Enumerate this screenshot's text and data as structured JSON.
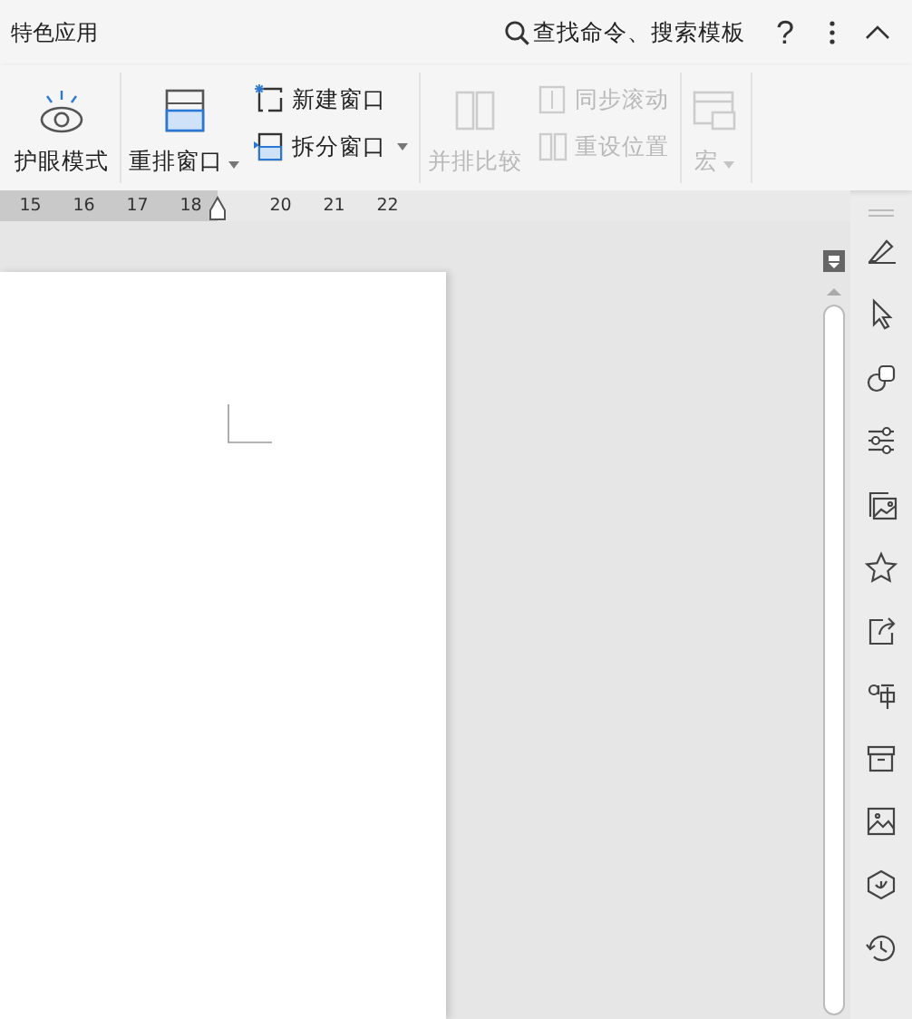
{
  "header": {
    "title": "特色应用",
    "search": "查找命令、搜索模板",
    "help": "?"
  },
  "ribbon": {
    "groups": [
      {
        "large": {
          "label": "护眼模式",
          "disabled": false,
          "dropdown": false
        }
      },
      {
        "large": {
          "label": "重排窗口",
          "disabled": false,
          "dropdown": true
        },
        "small": [
          {
            "label": "新建窗口",
            "disabled": false,
            "dropdown": false
          },
          {
            "label": "拆分窗口",
            "disabled": false,
            "dropdown": true
          }
        ]
      },
      {
        "large": {
          "label": "并排比较",
          "disabled": true,
          "dropdown": false
        },
        "small": [
          {
            "label": "同步滚动",
            "disabled": true,
            "dropdown": false
          },
          {
            "label": "重设位置",
            "disabled": true,
            "dropdown": false
          }
        ]
      },
      {
        "large": {
          "label": "宏",
          "disabled": true,
          "dropdown": true
        }
      }
    ]
  },
  "ruler": {
    "ticks": [
      "15",
      "16",
      "17",
      "18",
      "20",
      "21",
      "22"
    ]
  }
}
